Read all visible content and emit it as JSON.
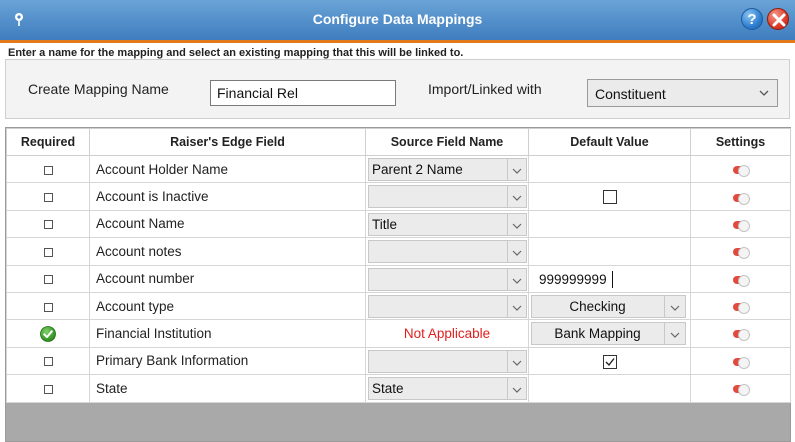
{
  "window": {
    "title": "Configure  Data Mappings",
    "help_label": "?"
  },
  "instructions": "Enter a name for the mapping and select an existing mapping that this will be linked to.",
  "mapping_name": {
    "label": "Create Mapping Name",
    "value": "Financial Rel"
  },
  "import_linked": {
    "label": "Import/Linked with",
    "value": "Constituent"
  },
  "grid": {
    "columns": [
      "Required",
      "Raiser's Edge Field",
      "Source Field Name",
      "Default Value",
      "Settings"
    ],
    "rows": [
      {
        "required": "checkbox",
        "field": "Account Holder Name",
        "source": "Parent 2 Name",
        "default_type": "blank",
        "default": ""
      },
      {
        "required": "checkbox",
        "field": "Account is Inactive",
        "source": "",
        "default_type": "checkbox",
        "default": "unchecked"
      },
      {
        "required": "checkbox",
        "field": "Account Name",
        "source": "Title",
        "default_type": "blank",
        "default": ""
      },
      {
        "required": "checkbox",
        "field": "Account notes",
        "source": "",
        "default_type": "blank",
        "default": ""
      },
      {
        "required": "checkbox",
        "field": "Account number",
        "source": "",
        "default_type": "input",
        "default": "999999999"
      },
      {
        "required": "checkbox",
        "field": "Account type",
        "source": "",
        "default_type": "select",
        "default": "Checking"
      },
      {
        "required": "check-icon",
        "field": "Financial Institution",
        "source": "Not Applicable",
        "default_type": "select",
        "default": "Bank Mapping"
      },
      {
        "required": "checkbox",
        "field": "Primary Bank Information",
        "source": "",
        "default_type": "checkbox",
        "default": "checked"
      },
      {
        "required": "checkbox",
        "field": "State",
        "source": "State",
        "default_type": "blank",
        "default": ""
      }
    ]
  },
  "colors": {
    "titlebar": "#3e7dbf",
    "accent_line": "#e07a1a",
    "not_applicable": "#e02020",
    "toggle": "#e14a3c"
  }
}
